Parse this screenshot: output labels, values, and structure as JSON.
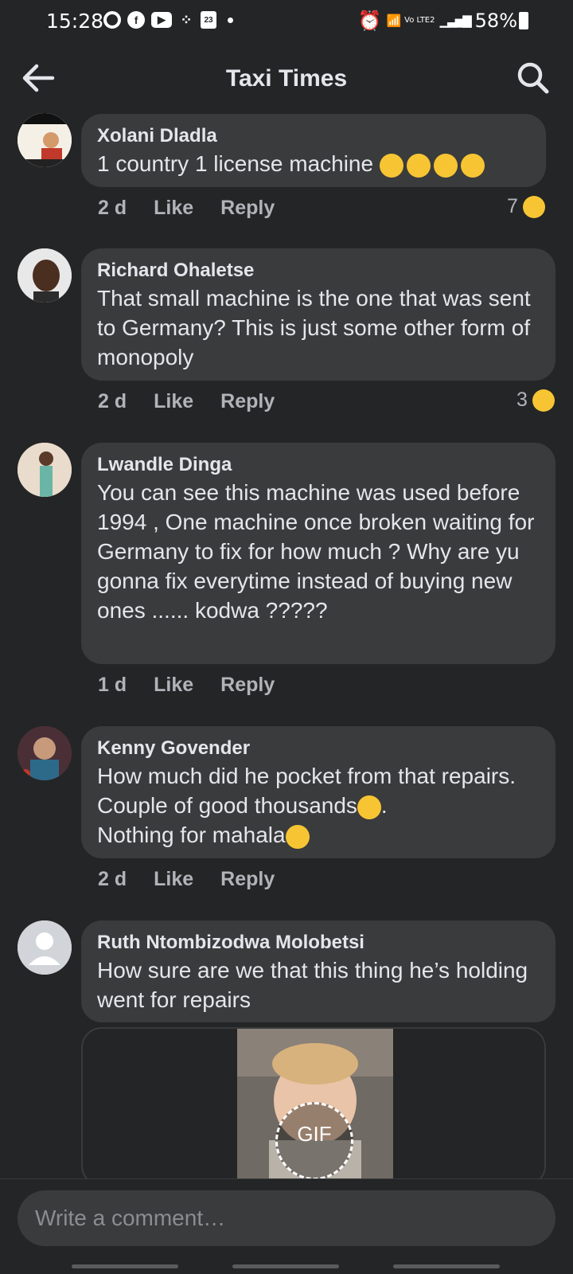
{
  "status_bar": {
    "time": "15:28",
    "calendar_day": "23",
    "network": "Vo LTE2",
    "battery": "58%"
  },
  "header": {
    "title": "Taxi Times"
  },
  "comments": [
    {
      "author": "Xolani Dladla",
      "text": "1 country 1 license machine",
      "text_emojis": [
        "rolling-laughing",
        "rolling-laughing",
        "rolling-laughing",
        "rolling-laughing"
      ],
      "time": "2 d",
      "like": "Like",
      "reply": "Reply",
      "reaction_count": "7",
      "reaction_icon": "laughing-emoji"
    },
    {
      "author": "Richard Ohaletse",
      "text": "That small machine is the one that was sent to Germany? This is just some other form of monopoly",
      "time": "2 d",
      "like": "Like",
      "reply": "Reply",
      "reaction_count": "3",
      "reaction_icon": "laughing-emoji"
    },
    {
      "author": "Lwandle Dinga",
      "text": "You can see this machine was used before 1994 ,  One machine  once broken waiting for Germany to fix  for how much ? Why are yu gonna fix everytime instead of buying new ones ...... kodwa ?????",
      "time": "1 d",
      "like": "Like",
      "reply": "Reply"
    },
    {
      "author": "Kenny Govender",
      "text_part1": "How much did he pocket from that repairs. Couple of good thousands",
      "text_part2": ".",
      "text_part3": "Nothing for mahala",
      "emoji_1": "thinking-emoji",
      "emoji_2": "eye-roll-emoji",
      "time": "2 d",
      "like": "Like",
      "reply": "Reply"
    },
    {
      "author": "Ruth Ntombizodwa Molobetsi",
      "text": "How sure are we that this thing he’s holding went for repairs",
      "attachment_label": "GIF"
    }
  ],
  "composer": {
    "placeholder": "Write a comment…"
  },
  "colors": {
    "background": "#242526",
    "bubble": "#3a3b3c",
    "text_primary": "#e4e6eb",
    "text_secondary": "#b0b3b8",
    "reaction_yellow": "#f7c533"
  }
}
